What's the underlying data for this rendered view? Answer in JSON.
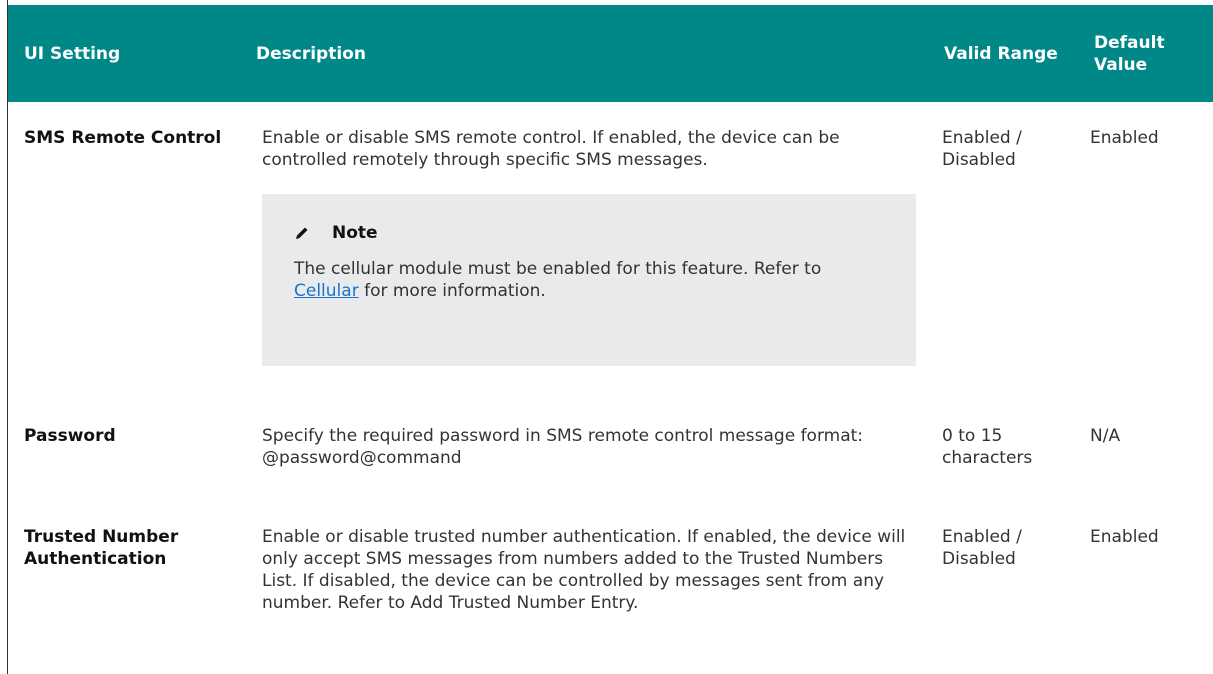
{
  "header": {
    "ui_setting": "UI Setting",
    "description": "Description",
    "valid_range": "Valid Range",
    "default_value": "Default Value"
  },
  "rows": [
    {
      "setting": "SMS Remote Control",
      "description": "Enable or disable SMS remote control. If enabled, the device can be controlled remotely through specific SMS messages.",
      "valid_range": "Enabled / Disabled",
      "default_value": "Enabled",
      "note": {
        "icon": "pencil-icon",
        "title": "Note",
        "text_before": "The cellular module must be enabled for this feature. Refer to ",
        "link": "Cellular",
        "text_after": " for more information."
      }
    },
    {
      "setting": "Password",
      "description": "Specify the required password in SMS remote control message format: @password@command",
      "valid_range": "0 to 15 characters",
      "default_value": "N/A"
    },
    {
      "setting": "Trusted Number Authentication",
      "description": "Enable or disable trusted number authentication. If enabled, the device will only accept SMS messages from numbers added to the Trusted Numbers List. If disabled, the device can be controlled by messages sent from any number. Refer to Add Trusted Number Entry.",
      "valid_range": "Enabled / Disabled",
      "default_value": "Enabled"
    }
  ],
  "colors": {
    "header_bg": "#008787",
    "note_bg": "#e9eaeb",
    "link": "#1a73c9"
  }
}
